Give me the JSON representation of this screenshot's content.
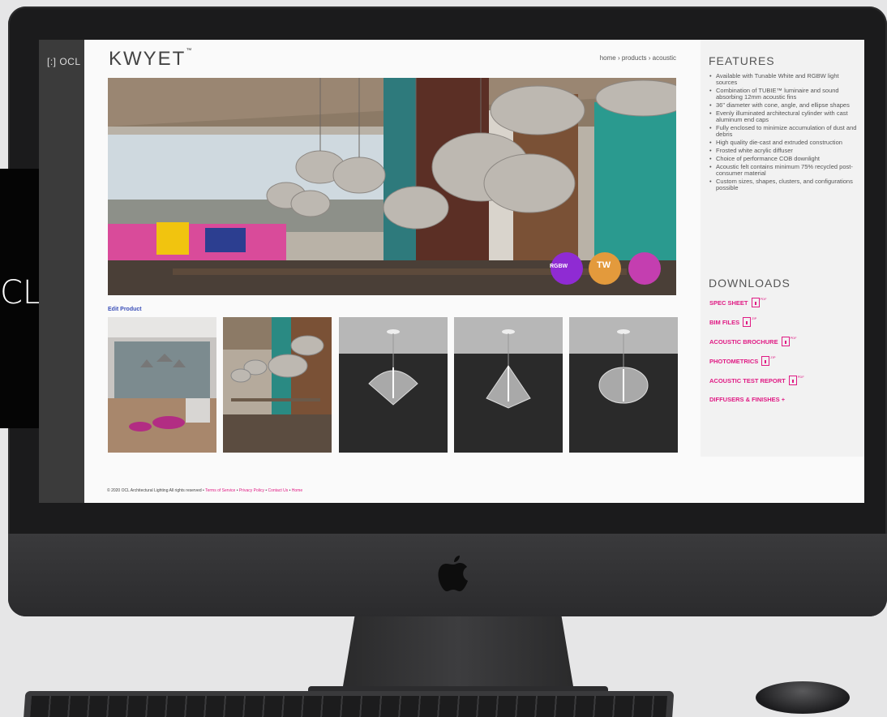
{
  "overlay_text": "CL",
  "rail": {
    "logo": "[:] OCL"
  },
  "header": {
    "title": "KWYET",
    "trademark": "™",
    "breadcrumb": "home › products › acoustic"
  },
  "hero": {
    "badges": [
      "RGBW",
      "TW"
    ]
  },
  "edit_link": "Edit Product",
  "features": {
    "title": "FEATURES",
    "items": [
      "Available with Tunable White and RGBW light sources",
      "Combination of TUBIE™ luminaire and sound absorbing 12mm acoustic fins",
      "36\" diameter with cone, angle, and ellipse shapes",
      "Evenly illuminated architectural cylinder with cast aluminum end caps",
      "Fully enclosed to minimize accumulation of dust and debris",
      "High quality die-cast and extruded construction",
      "Frosted white acrylic diffuser",
      "Choice of performance COB downlight",
      "Acoustic felt contains minimum 75% recycled post-consumer material",
      "Custom sizes, shapes, clusters, and configurations possible"
    ]
  },
  "downloads": {
    "title": "DOWNLOADS",
    "items": [
      {
        "label": "SPEC SHEET",
        "ext": "PDF"
      },
      {
        "label": "BIM FILES",
        "ext": "ZIP"
      },
      {
        "label": "ACOUSTIC BROCHURE",
        "ext": "PDF"
      },
      {
        "label": "PHOTOMETRICS",
        "ext": "ZIP"
      },
      {
        "label": "ACOUSTIC TEST REPORT",
        "ext": "PDF"
      },
      {
        "label": "DIFFUSERS & FINISHES +",
        "ext": ""
      }
    ]
  },
  "footer": {
    "copyright": "© 2020 OCL Architectural Lighting All rights reserved •",
    "links": [
      "Terms of Service",
      "Privacy Policy",
      "Contact Us",
      "Home"
    ]
  },
  "colors": {
    "accent": "#e01b84",
    "rail": "#3b3b3b",
    "link": "#3b4fb8"
  }
}
